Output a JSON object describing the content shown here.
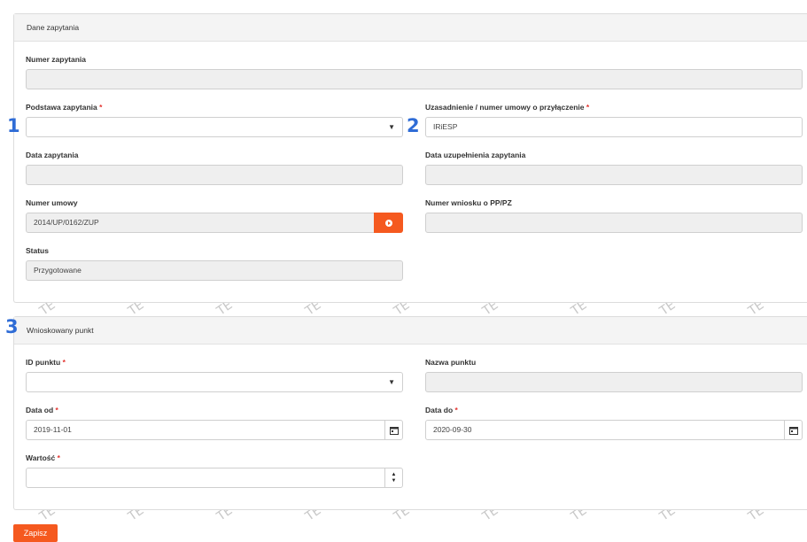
{
  "section1": {
    "title": "Dane zapytania",
    "numer_zapytania": {
      "label": "Numer zapytania",
      "value": ""
    },
    "podstawa": {
      "label": "Podstawa zapytania",
      "required_mark": "*",
      "value": ""
    },
    "uzasadnienie": {
      "label": "Uzasadnienie / numer umowy o przyłączenie",
      "required_mark": "*",
      "value": "IRiESP"
    },
    "data_zapytania": {
      "label": "Data zapytania",
      "value": ""
    },
    "data_uzupelnienia": {
      "label": "Data uzupełnienia zapytania",
      "value": ""
    },
    "numer_umowy": {
      "label": "Numer umowy",
      "value": "2014/UP/0162/ZUP"
    },
    "numer_wniosku": {
      "label": "Numer wniosku o PP/PZ",
      "value": ""
    },
    "status": {
      "label": "Status",
      "value": "Przygotowane"
    }
  },
  "section2": {
    "title": "Wnioskowany punkt",
    "id_punktu": {
      "label": "ID punktu",
      "required_mark": "*",
      "value": ""
    },
    "nazwa_punktu": {
      "label": "Nazwa punktu",
      "value": ""
    },
    "data_od": {
      "label": "Data od",
      "required_mark": "*",
      "value": "2019-11-01"
    },
    "data_do": {
      "label": "Data do",
      "required_mark": "*",
      "value": "2020-09-30"
    },
    "wartosc": {
      "label": "Wartość",
      "required_mark": "*",
      "value": ""
    }
  },
  "markers": {
    "m1": "1",
    "m2": "2",
    "m3": "3"
  },
  "watermark": "TE",
  "save_label": "Zapisz",
  "colors": {
    "accent": "#f5591f",
    "marker": "#2f6cd6",
    "required": "#e3342f"
  },
  "icons": {
    "dropdown": "caret-down-icon",
    "calendar": "calendar-icon",
    "spinner": "spinner-arrows-icon",
    "go": "arrow-circle-right-icon"
  }
}
